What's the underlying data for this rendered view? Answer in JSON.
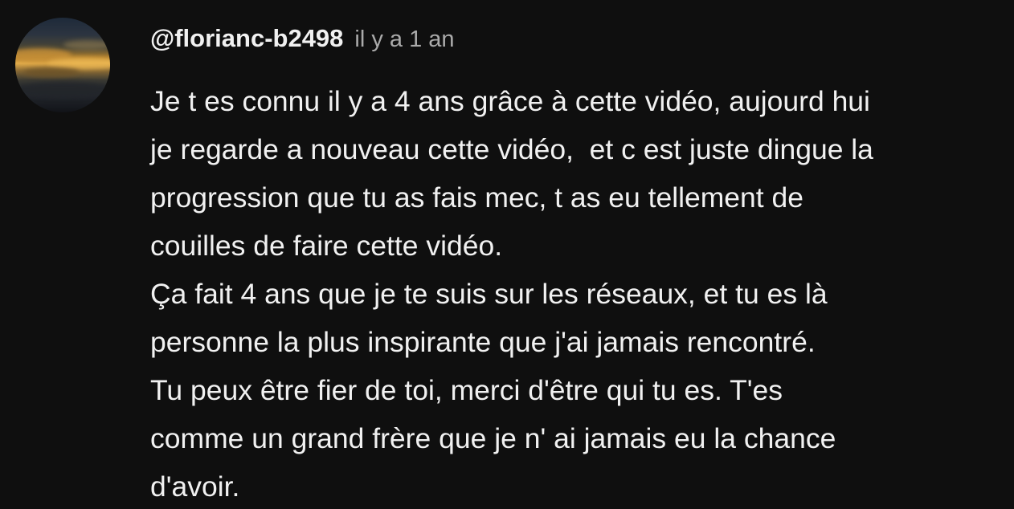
{
  "comment": {
    "author": "@florianc-b2498",
    "timestamp": "il y a 1 an",
    "lines": [
      "Je t es connu il y a 4 ans grâce à cette vidéo, aujourd hui",
      "je regarde a nouveau cette vidéo,  et c est juste dingue la",
      "progression que tu as fais mec, t as eu tellement de",
      "couilles de faire cette vidéo.",
      "Ça fait 4 ans que je te suis sur les réseaux, et tu es là",
      "personne la plus inspirante que j'ai jamais rencontré.",
      "Tu peux être fier de toi, merci d'être qui tu es. T'es",
      "comme un grand frère que je n' ai jamais eu la chance",
      "d'avoir."
    ]
  }
}
